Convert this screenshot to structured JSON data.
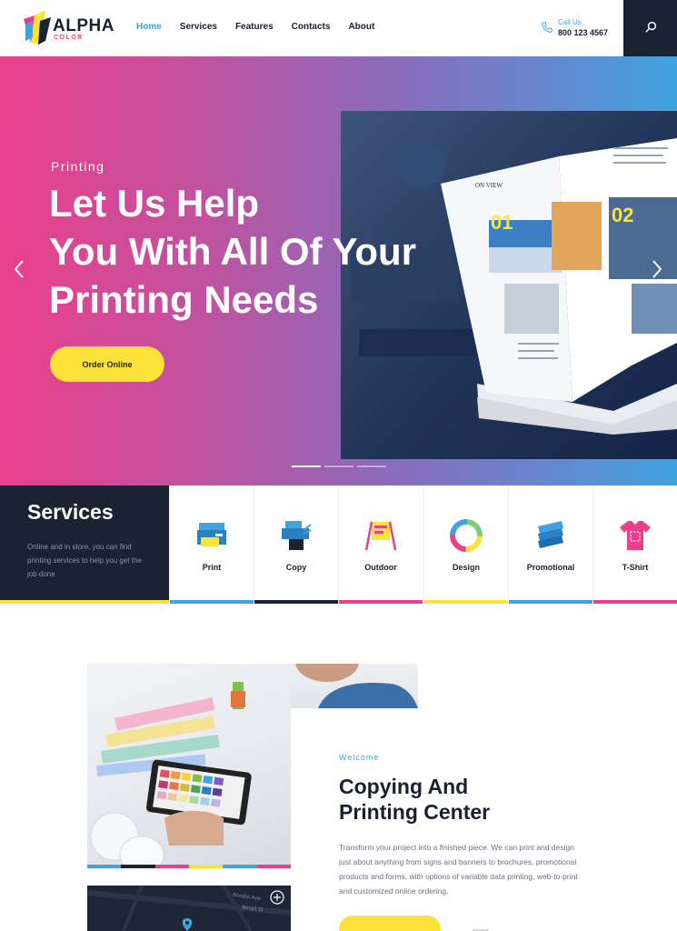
{
  "brand": {
    "name": "ALPHA",
    "sub": "COLOR"
  },
  "nav": {
    "items": [
      {
        "label": "Home",
        "active": true
      },
      {
        "label": "Services",
        "active": false
      },
      {
        "label": "Features",
        "active": false
      },
      {
        "label": "Contacts",
        "active": false
      },
      {
        "label": "About",
        "active": false
      }
    ]
  },
  "header": {
    "call_label": "Call Us",
    "phone": "800 123 4567"
  },
  "hero": {
    "kicker": "Printing",
    "title_lines": [
      "Let Us Help",
      "You With All Of Your",
      "Printing Needs"
    ],
    "button": "Order Online",
    "slides_total": 3,
    "active_slide": 1
  },
  "services": {
    "title": "Services",
    "description": "Online and in store, you can find printing services to help you get the job done",
    "items": [
      {
        "label": "Print",
        "icon": "printer-icon",
        "bar_color": "#3fa3e0"
      },
      {
        "label": "Copy",
        "icon": "copier-icon",
        "bar_color": "#1b2333"
      },
      {
        "label": "Outdoor",
        "icon": "easel-sign-icon",
        "bar_color": "#ea3f8a"
      },
      {
        "label": "Design",
        "icon": "color-wheel-icon",
        "bar_color": "#fde23a"
      },
      {
        "label": "Promotional",
        "icon": "layers-icon",
        "bar_color": "#3fa3e0"
      },
      {
        "label": "T-Shirt",
        "icon": "tshirt-icon",
        "bar_color": "#ea3f8a"
      }
    ],
    "intro_bar_color": "#fde23a"
  },
  "welcome": {
    "kicker": "Welcome",
    "title_lines": [
      "Copying And",
      "Printing Center"
    ],
    "body": "Transform your project into a finished piece. We can print and design just about anything from signs and banners to brochures, promotional products and forms, with options of variable data printing, web-to-print and customized online ordering.",
    "map_labels": [
      "Bordon Ave",
      "Broad St"
    ]
  },
  "colors": {
    "accent_blue": "#35a7e0",
    "accent_pink": "#ea3f8a",
    "accent_yellow": "#fde23a",
    "dark": "#1b2333"
  }
}
